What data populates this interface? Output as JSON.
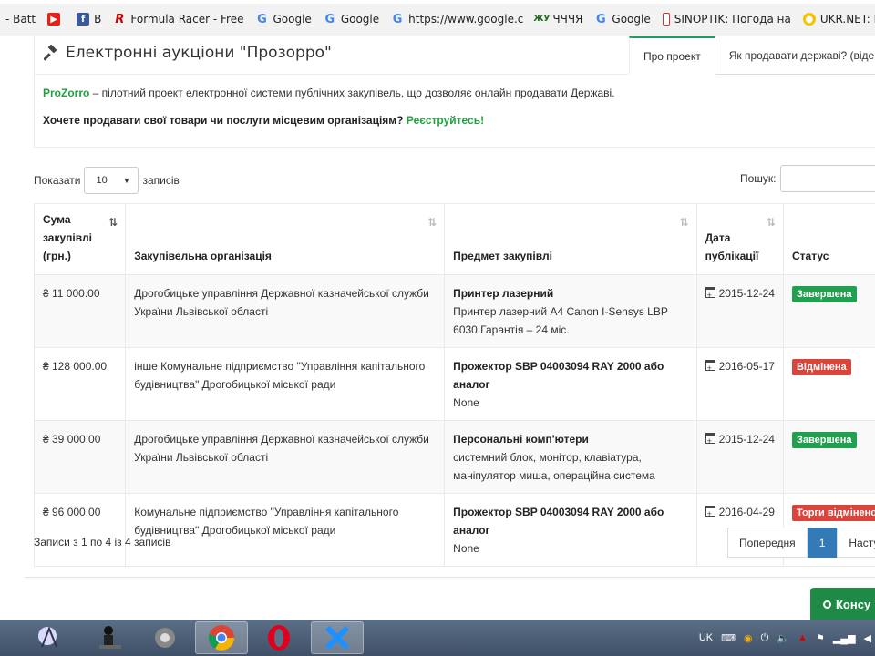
{
  "bookmarks": [
    {
      "label": "- Batt",
      "icon": "none"
    },
    {
      "label": "",
      "icon": "youtube-icon"
    },
    {
      "label": "B",
      "icon": "facebook-icon"
    },
    {
      "label": "Formula Racer - Free",
      "icon": "formula-racer-icon"
    },
    {
      "label": "Google",
      "icon": "google-icon"
    },
    {
      "label": "Google",
      "icon": "google-icon"
    },
    {
      "label": "https://www.google.c",
      "icon": "google-icon"
    },
    {
      "label": "ЧЧЧЯ",
      "icon": "site-icon"
    },
    {
      "label": "Google",
      "icon": "google-icon"
    },
    {
      "label": "SINOPTIK: Погода на",
      "icon": "sinoptik-icon"
    },
    {
      "label": "UKR.NET: Всі нов",
      "icon": "ukrnet-icon"
    }
  ],
  "header": {
    "title": "Електронні аукціони \"Прозорро\"",
    "tabs": [
      {
        "label": "Про проект",
        "active": true
      },
      {
        "label": "Як продавати державі? (віде",
        "active": false
      }
    ]
  },
  "intro": {
    "brand": "ProZorro",
    "text": " – пілотний проект електронної системи публічних закупівель, що дозволяє онлайн продавати Державі.",
    "call": "Хочете продавати свої товари чи послуги місцевим організаціям?",
    "register": "Реєструйтесь!"
  },
  "controls": {
    "show_label": "Показати",
    "page_size": "10",
    "records_label": "записів",
    "search_label": "Пошук:"
  },
  "table": {
    "headers": {
      "sum": "Сума закупівлі (грн.)",
      "org": "Закупівельна організація",
      "subject": "Предмет закупівлі",
      "date": "Дата публікації",
      "status": "Статус"
    },
    "rows": [
      {
        "sum": "₴ 11 000.00",
        "org": "Дрогобицьке управління Державної казначейської служби України Львівської області",
        "subject_title": "Принтер лазерний",
        "subject_desc": "Принтер лазерний А4 Canon I-Sensys LBP 6030 Гарантія – 24 міс.",
        "date": "2015-12-24",
        "status": "Завершена",
        "status_color": "#21a150"
      },
      {
        "sum": "₴ 128 000.00",
        "org": "інше Комунальне підприємство \"Управління капітального будівництва\" Дрогобицької міської ради",
        "subject_title": "Прожектор SBP 04003094 RAY 2000 або аналог",
        "subject_desc": "None",
        "date": "2016-05-17",
        "status": "Відмінена",
        "status_color": "#d9453b"
      },
      {
        "sum": "₴ 39 000.00",
        "org": "Дрогобицьке управління Державної казначейської служби України Львівської області",
        "subject_title": "Персональні комп'ютери",
        "subject_desc": "системний блок, монітор, клавіатура, маніпулятор миша, операційна система",
        "date": "2015-12-24",
        "status": "Завершена",
        "status_color": "#21a150"
      },
      {
        "sum": "₴ 96 000.00",
        "org": "Комунальне підприємство \"Управління капітального будівництва\" Дрогобицької міської ради",
        "subject_title": "Прожектор SBP 04003094 RAY 2000 або аналог",
        "subject_desc": "None",
        "date": "2016-04-29",
        "status": "Торги відмінено",
        "status_color": "#d9453b"
      }
    ]
  },
  "footer": {
    "info": "Записи з 1 по 4 із 4 записів",
    "prev": "Попередня",
    "page": "1",
    "next": "Наступ"
  },
  "consult": {
    "label": "Консу"
  },
  "taskbar": {
    "lang": "UK"
  }
}
